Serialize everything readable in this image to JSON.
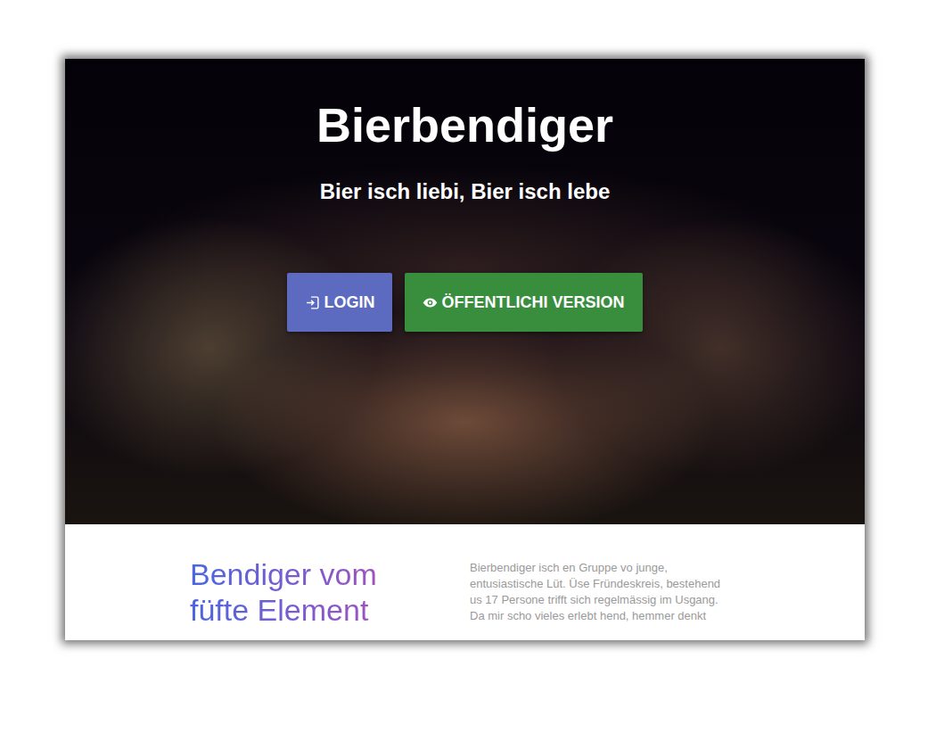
{
  "hero": {
    "title": "Bierbendiger",
    "subtitle": "Bier isch liebi, Bier isch lebe",
    "buttons": [
      {
        "label": "LOGIN",
        "kind": "login",
        "color": "#5c6bc0"
      },
      {
        "label": "ÖFFENTLICHI VERSION",
        "kind": "public",
        "color": "#388e3c"
      }
    ]
  },
  "about": {
    "heading_lines": [
      "Bendiger vom",
      "füfte Element"
    ],
    "paragraph_lines": [
      "Bierbendiger isch en Gruppe vo junge,",
      "entusiastische Lüt. Üse Fründeskreis, bestehend",
      "us 17 Persone trifft sich regelmässig im Usgang.",
      "Da mir scho vieles erlebt hend, hemmer denkt"
    ]
  }
}
